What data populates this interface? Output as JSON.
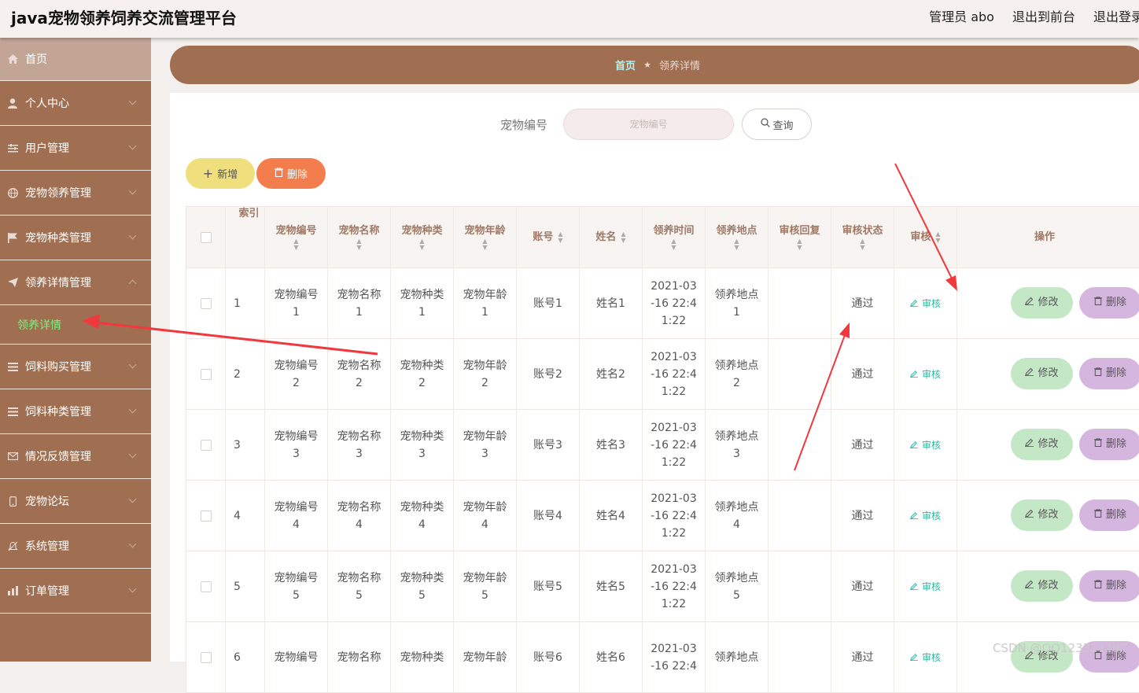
{
  "app_title": "java宠物领养饲养交流管理平台",
  "top_links": [
    "管理员 abo",
    "退出到前台",
    "退出登录"
  ],
  "sidebar": {
    "items": [
      {
        "label": "首页",
        "icon": "home-icon"
      },
      {
        "label": "个人中心",
        "icon": "user-icon"
      },
      {
        "label": "用户管理",
        "icon": "sliders-icon"
      },
      {
        "label": "宠物领养管理",
        "icon": "globe-icon"
      },
      {
        "label": "宠物种类管理",
        "icon": "flag-icon"
      },
      {
        "label": "领养详情管理",
        "icon": "send-icon",
        "expanded": true
      },
      {
        "label": "饲料购买管理",
        "icon": "list-icon"
      },
      {
        "label": "饲料种类管理",
        "icon": "list-icon"
      },
      {
        "label": "情况反馈管理",
        "icon": "mail-icon"
      },
      {
        "label": "宠物论坛",
        "icon": "mobile-icon"
      },
      {
        "label": "系统管理",
        "icon": "bell-off-icon"
      },
      {
        "label": "订单管理",
        "icon": "chart-icon"
      }
    ],
    "submenu_active": "领养详情"
  },
  "breadcrumb": {
    "home": "首页",
    "current": "领养详情"
  },
  "search": {
    "label": "宠物编号",
    "placeholder": "宠物编号",
    "button": "查询"
  },
  "actions": {
    "add": "新增",
    "delete": "删除"
  },
  "table": {
    "headers": [
      "索引",
      "宠物编号",
      "宠物名称",
      "宠物种类",
      "宠物年龄",
      "账号",
      "姓名",
      "领养时间",
      "领养地点",
      "审核回复",
      "审核状态",
      "审核",
      "操作"
    ],
    "rows": [
      {
        "index": "1",
        "pet_no": "宠物编号\n1",
        "pet_name": "宠物名称\n1",
        "pet_kind": "宠物种类\n1",
        "pet_age": "宠物年龄\n1",
        "account": "账号1",
        "name": "姓名1",
        "time": "2021-03\n-16 22:4\n1:22",
        "place": "领养地点\n1",
        "reply": "",
        "status": "通过"
      },
      {
        "index": "2",
        "pet_no": "宠物编号\n2",
        "pet_name": "宠物名称\n2",
        "pet_kind": "宠物种类\n2",
        "pet_age": "宠物年龄\n2",
        "account": "账号2",
        "name": "姓名2",
        "time": "2021-03\n-16 22:4\n1:22",
        "place": "领养地点\n2",
        "reply": "",
        "status": "通过"
      },
      {
        "index": "3",
        "pet_no": "宠物编号\n3",
        "pet_name": "宠物名称\n3",
        "pet_kind": "宠物种类\n3",
        "pet_age": "宠物年龄\n3",
        "account": "账号3",
        "name": "姓名3",
        "time": "2021-03\n-16 22:4\n1:22",
        "place": "领养地点\n3",
        "reply": "",
        "status": "通过"
      },
      {
        "index": "4",
        "pet_no": "宠物编号\n4",
        "pet_name": "宠物名称\n4",
        "pet_kind": "宠物种类\n4",
        "pet_age": "宠物年龄\n4",
        "account": "账号4",
        "name": "姓名4",
        "time": "2021-03\n-16 22:4\n1:22",
        "place": "领养地点\n4",
        "reply": "",
        "status": "通过"
      },
      {
        "index": "5",
        "pet_no": "宠物编号\n5",
        "pet_name": "宠物名称\n5",
        "pet_kind": "宠物种类\n5",
        "pet_age": "宠物年龄\n5",
        "account": "账号5",
        "name": "姓名5",
        "time": "2021-03\n-16 22:4\n1:22",
        "place": "领养地点\n5",
        "reply": "",
        "status": "通过"
      },
      {
        "index": "6",
        "pet_no": "宠物编号",
        "pet_name": "宠物名称",
        "pet_kind": "宠物种类",
        "pet_age": "宠物年龄",
        "account": "账号6",
        "name": "姓名6",
        "time": "2021-03\n-16 22:4",
        "place": "领养地点",
        "reply": "",
        "status": "通过"
      }
    ],
    "row_audit_label": "审核",
    "row_edit_label": "修改",
    "row_delete_label": "删除"
  },
  "watermark": "CSDN @QQ123311197",
  "colors": {
    "sidebar": "#a06f52",
    "active_submenu": "#7ef07e",
    "add_button": "#f0e07d",
    "delete_button": "#f37d4c",
    "edit_pill": "#c4e7c6",
    "delete_pill": "#d5b6df",
    "arrow": "#f0383d"
  }
}
